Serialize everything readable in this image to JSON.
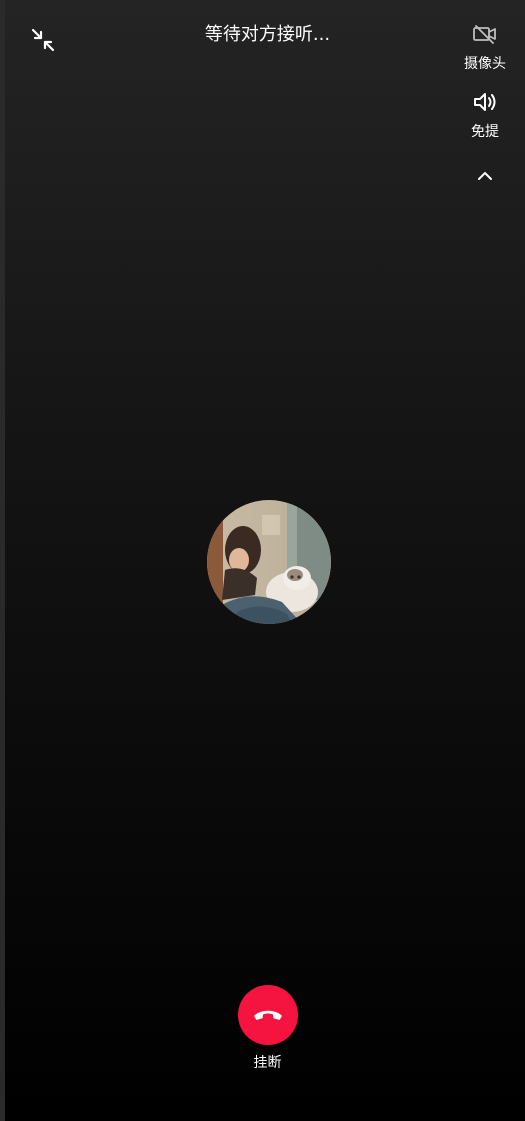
{
  "header": {
    "title": "等待对方接听...",
    "minimize_icon": "minimize-arrows-icon"
  },
  "controls": {
    "camera": {
      "label": "摄像头",
      "icon": "camera-off-icon"
    },
    "speaker": {
      "label": "免提",
      "icon": "speaker-icon"
    },
    "collapse_icon": "chevron-up-icon"
  },
  "call": {
    "avatar": "avatar-photo-girl-with-cat",
    "hangup": {
      "label": "挂断",
      "icon": "hangup-phone-icon",
      "color": "#f5133f"
    }
  },
  "colors": {
    "background_top": "#242424",
    "background_bottom": "#000000",
    "text": "#ffffff"
  }
}
